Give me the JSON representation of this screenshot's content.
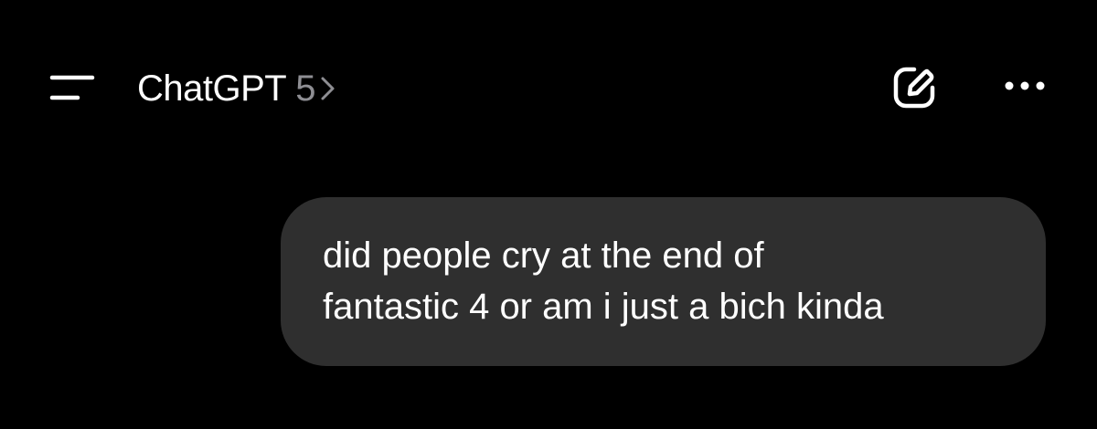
{
  "header": {
    "menu_icon": "menu-lines-icon",
    "title": "ChatGPT",
    "model_version": "5",
    "chevron_icon": "chevron-right-icon",
    "compose_icon": "new-chat-compose-icon",
    "more_icon": "more-dots-icon"
  },
  "conversation": {
    "user_message": {
      "lines": [
        "did people cry at the end of",
        "fantastic 4 or am i just a bich kinda"
      ]
    }
  },
  "colors": {
    "background": "#000000",
    "bubble": "#2f2f2f",
    "text": "#ffffff",
    "secondary_text": "#8e8e93"
  }
}
